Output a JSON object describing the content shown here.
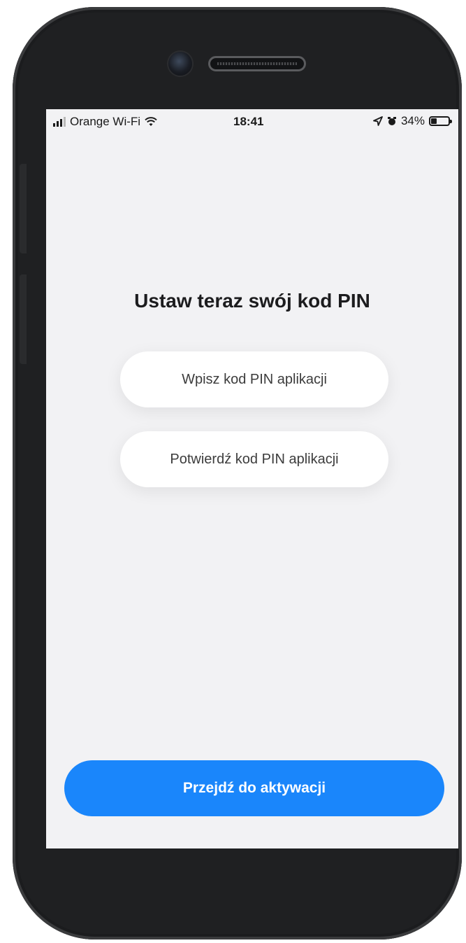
{
  "status_bar": {
    "carrier": "Orange Wi-Fi",
    "time": "18:41",
    "battery_percent": "34%",
    "battery_level": 0.34,
    "icons": [
      "signal-icon",
      "wifi-icon",
      "location-icon",
      "alarm-icon",
      "battery-icon"
    ]
  },
  "main": {
    "title": "Ustaw teraz swój kod PIN",
    "pin_field": {
      "placeholder": "Wpisz kod PIN aplikacji",
      "value": ""
    },
    "confirm_pin_field": {
      "placeholder": "Potwierdź kod PIN aplikacji",
      "value": ""
    }
  },
  "footer": {
    "activate_label": "Przejdź do aktywacji"
  },
  "colors": {
    "accent": "#1a86fb",
    "screen_background": "#f2f2f4",
    "device_frame": "#1f2022"
  }
}
